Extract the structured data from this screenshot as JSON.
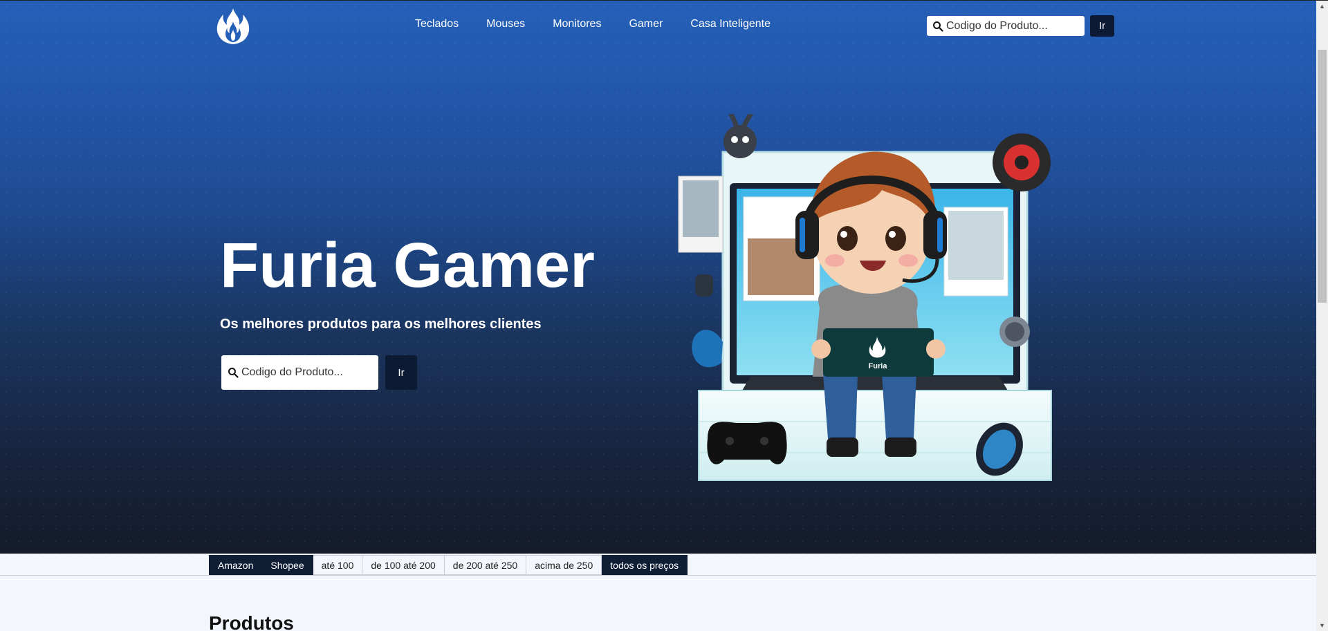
{
  "nav": {
    "logo": "flame-logo",
    "links": [
      "Teclados",
      "Mouses",
      "Monitores",
      "Gamer",
      "Casa Inteligente"
    ],
    "search_placeholder": "Codigo do Produto...",
    "go_label": "Ir"
  },
  "hero": {
    "title": "Furia Gamer",
    "subtitle": "Os melhores produtos para os melhores clientes",
    "search_placeholder": "Codigo do Produto...",
    "go_label": "Ir",
    "tablet_text": "Furia"
  },
  "filters": [
    {
      "label": "Amazon",
      "style": "dark"
    },
    {
      "label": "Shopee",
      "style": "dark"
    },
    {
      "label": "até 100",
      "style": "light"
    },
    {
      "label": "de 100 até 200",
      "style": "light"
    },
    {
      "label": "de 200 até 250",
      "style": "light"
    },
    {
      "label": "acima de 250",
      "style": "light"
    },
    {
      "label": "todos os preços",
      "style": "dark"
    }
  ],
  "products": {
    "title": "Produtos"
  },
  "colors": {
    "hero_top": "#2560b8",
    "hero_bottom": "#151b2b",
    "button_dark": "#0d1a33",
    "page_bg": "#f3f6fc"
  }
}
